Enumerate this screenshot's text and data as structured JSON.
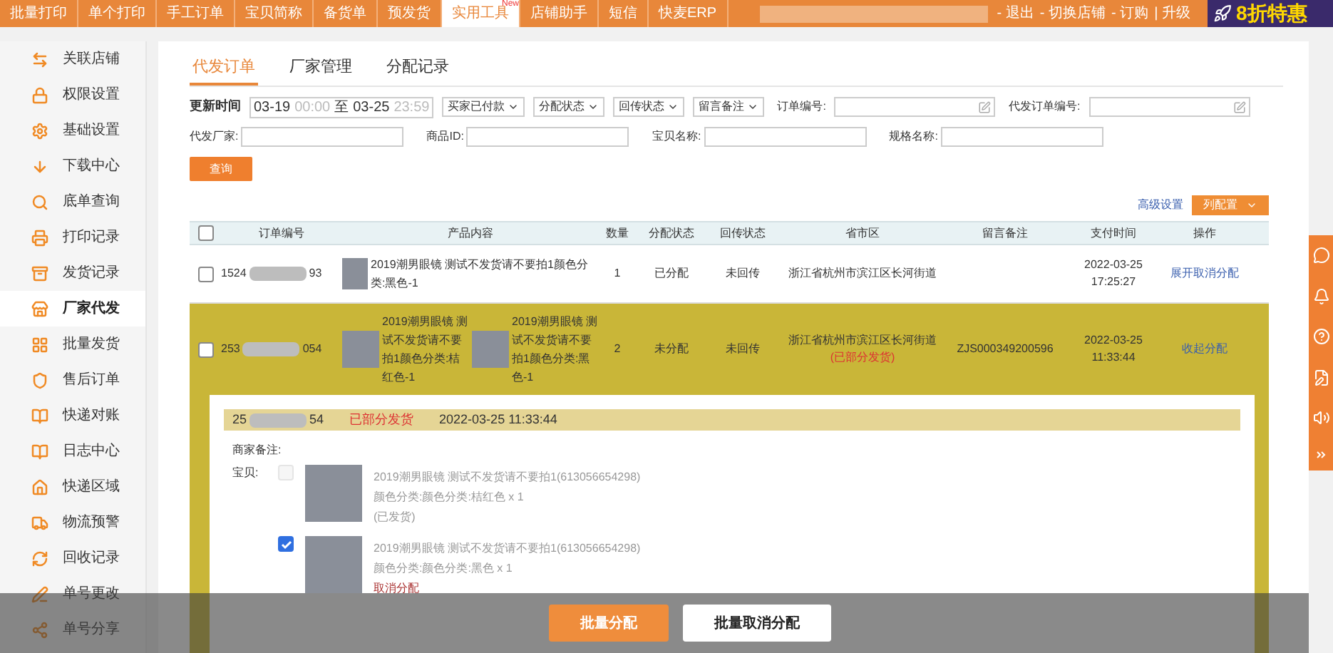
{
  "top_nav": {
    "items": [
      {
        "label": "批量打印",
        "selected": false
      },
      {
        "label": "单个打印",
        "selected": false
      },
      {
        "label": "手工订单",
        "selected": false
      },
      {
        "label": "宝贝简称",
        "selected": false
      },
      {
        "label": "备货单",
        "selected": false
      },
      {
        "label": "预发货",
        "selected": false
      },
      {
        "label": "实用工具",
        "selected": true,
        "badge": "New"
      },
      {
        "label": "店铺助手",
        "selected": false
      },
      {
        "label": "短信",
        "selected": false
      },
      {
        "label": "快麦ERP",
        "selected": false
      }
    ],
    "user_links": [
      "- 退出",
      "- 切换店铺",
      "- 订购",
      "| 升级"
    ],
    "promo": "8折特惠"
  },
  "sidebar": {
    "items": [
      {
        "label": "关联店铺",
        "selected": false
      },
      {
        "label": "权限设置",
        "selected": false
      },
      {
        "label": "基础设置",
        "selected": false
      },
      {
        "label": "下载中心",
        "selected": false
      },
      {
        "label": "底单查询",
        "selected": false
      },
      {
        "label": "打印记录",
        "selected": false
      },
      {
        "label": "发货记录",
        "selected": false
      },
      {
        "label": "厂家代发",
        "selected": true
      },
      {
        "label": "批量发货",
        "selected": false
      },
      {
        "label": "售后订单",
        "selected": false
      },
      {
        "label": "快递对账",
        "selected": false
      },
      {
        "label": "日志中心",
        "selected": false
      },
      {
        "label": "快递区域",
        "selected": false
      },
      {
        "label": "物流预警",
        "selected": false
      },
      {
        "label": "回收记录",
        "selected": false
      },
      {
        "label": "单号更改",
        "selected": false
      },
      {
        "label": "单号分享",
        "selected": false
      }
    ]
  },
  "tabs": [
    {
      "label": "代发订单",
      "selected": true
    },
    {
      "label": "厂家管理",
      "selected": false
    },
    {
      "label": "分配记录",
      "selected": false
    }
  ],
  "filters": {
    "time_label": "更新时间",
    "start_date": "03-19",
    "start_time": "00:00",
    "separator": "至",
    "end_date": "03-25",
    "end_time": "23:59",
    "dropdowns": [
      "买家已付款",
      "分配状态",
      "回传状态",
      "留言备注"
    ],
    "fields_row1": [
      {
        "label": "订单编号:"
      },
      {
        "label": "代发订单编号:"
      }
    ],
    "fields_row2": [
      {
        "label": "代发厂家:"
      },
      {
        "label": "商品ID:"
      },
      {
        "label": "宝贝名称:"
      },
      {
        "label": "规格名称:"
      }
    ],
    "query_button": "查询"
  },
  "toolbar": {
    "advanced_link": "高级设置",
    "column_button": "列配置"
  },
  "table": {
    "header_checked": false,
    "columns": [
      "订单编号",
      "产品内容",
      "数量",
      "分配状态",
      "回传状态",
      "省市区",
      "留言备注",
      "支付时间",
      "操作"
    ],
    "rows": [
      {
        "checked": false,
        "highlighted": false,
        "order_start": "1524",
        "order_end": "93",
        "products": [
          {
            "text": "2019潮男眼镜 测试不发货请不要拍1颜色分类:黑色-1"
          }
        ],
        "qty": "1",
        "assign_status": "已分配",
        "return_status": "未回传",
        "region": "浙江省杭州市滨江区长河街道",
        "pay_time": "2022-03-25 17:25:27",
        "actions": [
          "展开",
          "取消分配"
        ]
      },
      {
        "checked": false,
        "highlighted": true,
        "order_start": "253",
        "order_end": "054",
        "products": [
          {
            "text": "2019潮男眼镜 测试不发货请不要拍1颜色分类:桔红色-1"
          },
          {
            "text": "2019潮男眼镜 测试不发货请不要拍1颜色分类:黑色-1"
          }
        ],
        "qty": "2",
        "assign_status": "未分配",
        "return_status": "未回传",
        "region": "浙江省杭州市滨江区长河街道",
        "region_note": "(已部分发货)",
        "remark": "ZJS000349200596",
        "pay_time": "2022-03-25 11:33:44",
        "actions": [
          "收起",
          "分配"
        ]
      }
    ]
  },
  "detail": {
    "order_start": "25",
    "order_end": "54",
    "status": "已部分发货",
    "time": "2022-03-25 11:33:44",
    "merchant_note_label": "商家备注:",
    "items_label": "宝贝:",
    "items": [
      {
        "checked": false,
        "disabled": true,
        "title": "2019潮男眼镜 测试不发货请不要拍1(613056654298)",
        "spec": "颜色分类:颜色分类:桔红色 x 1",
        "note": "(已发货)"
      },
      {
        "checked": true,
        "disabled": false,
        "title": "2019潮男眼镜 测试不发货请不要拍1(613056654298)",
        "spec": "颜色分类:颜色分类:黑色 x 1",
        "link": "取消分配"
      }
    ]
  },
  "bottom_bar": {
    "buttons": [
      {
        "label": "批量分配",
        "kind": "primary"
      },
      {
        "label": "批量取消分配",
        "kind": "secondary"
      }
    ]
  }
}
